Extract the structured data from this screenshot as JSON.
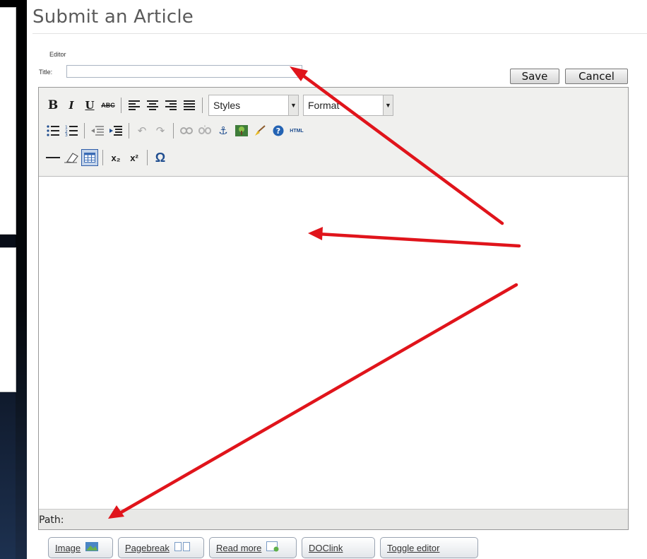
{
  "page": {
    "title": "Submit an Article",
    "editor_caption": "Editor",
    "title_label": "Title:",
    "title_value": ""
  },
  "actions": {
    "save_label": "Save",
    "cancel_label": "Cancel"
  },
  "toolbar": {
    "styles_label": "Styles",
    "format_label": "Format",
    "strikethrough_text": "ABC",
    "html_text": "HTML",
    "subscript_text": "x₂",
    "superscript_text": "x²",
    "special_char_text": "Ω"
  },
  "status_bar": {
    "path_label": "Path:"
  },
  "bottom_buttons": {
    "image_label": "Image",
    "pagebreak_label": "Pagebreak",
    "readmore_label": "Read more",
    "doclink_label": "DOClink",
    "toggle_label": "Toggle editor"
  },
  "colors": {
    "annotation_arrow": "#e0141b",
    "page_background": "#000000"
  }
}
